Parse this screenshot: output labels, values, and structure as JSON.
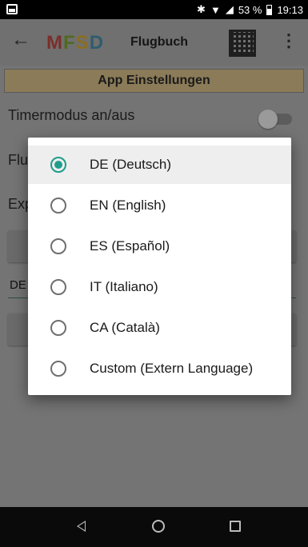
{
  "status_bar": {
    "battery_percent": "53 %",
    "time": "19:13",
    "icons": [
      "screenshot-icon",
      "bluetooth-icon",
      "wifi-icon",
      "signal-icon",
      "battery-icon"
    ]
  },
  "app_bar": {
    "logo": {
      "m": "M",
      "f": "F",
      "s": "S",
      "d": "D"
    },
    "title": "Flugbuch"
  },
  "settings": {
    "section_title": "App Einstellungen",
    "rows": [
      "Timermodus an/aus",
      "Flu",
      "Exp"
    ],
    "select_value": "DE",
    "toggle_on": false
  },
  "language_dialog": {
    "options": [
      {
        "label": "DE (Deutsch)",
        "selected": true
      },
      {
        "label": "EN (English)",
        "selected": false
      },
      {
        "label": "ES (Español)",
        "selected": false
      },
      {
        "label": "IT (Italiano)",
        "selected": false
      },
      {
        "label": "CA (Català)",
        "selected": false
      },
      {
        "label": "Custom (Extern Language)",
        "selected": false
      }
    ]
  },
  "colors": {
    "accent": "#1f9d8a",
    "section_header": "#8b7b58"
  }
}
